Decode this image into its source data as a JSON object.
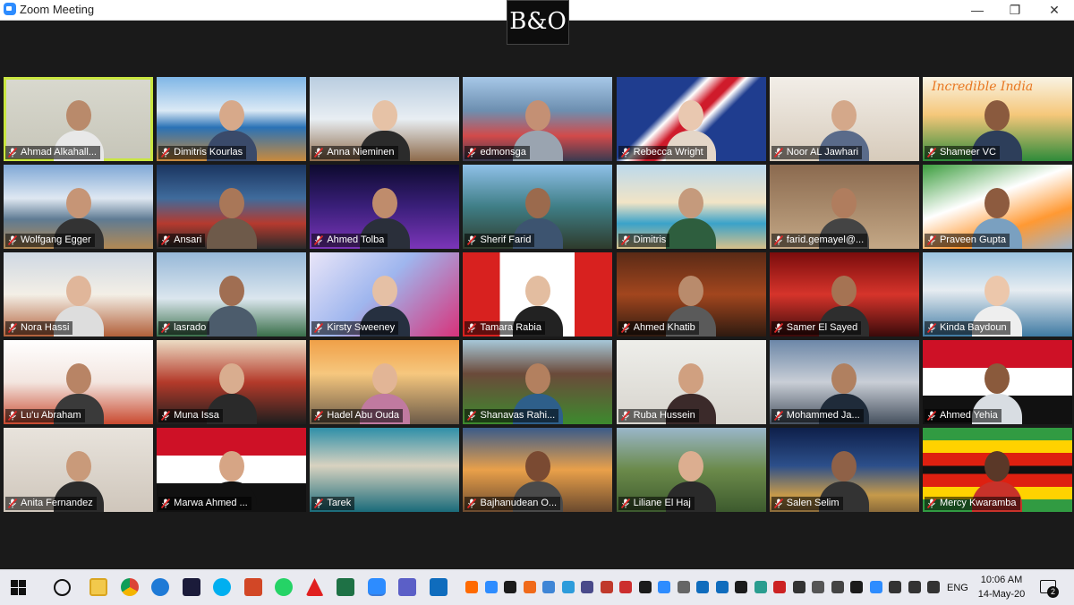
{
  "window": {
    "title": "Zoom Meeting",
    "logo_text": "B&O"
  },
  "participants": [
    {
      "name": "Ahmad Alkahall...",
      "active": true
    },
    {
      "name": "Dimitris Kourlas"
    },
    {
      "name": "Anna Nieminen"
    },
    {
      "name": "edmonsga"
    },
    {
      "name": "Rebecca Wright"
    },
    {
      "name": "Noor AL Jawhari"
    },
    {
      "name": "Shameer VC",
      "bg_text": "Incredible India"
    },
    {
      "name": "Wolfgang Egger"
    },
    {
      "name": "Ansari"
    },
    {
      "name": "Ahmed Tolba"
    },
    {
      "name": "Sherif Farid"
    },
    {
      "name": "Dimitris"
    },
    {
      "name": "farid.gemayel@..."
    },
    {
      "name": "Praveen Gupta"
    },
    {
      "name": "Nora Hassi"
    },
    {
      "name": "lasrado"
    },
    {
      "name": "Kirsty Sweeney"
    },
    {
      "name": "Tamara Rabia"
    },
    {
      "name": "Ahmed Khatib"
    },
    {
      "name": "Samer El Sayed"
    },
    {
      "name": "Kinda Baydoun"
    },
    {
      "name": "Lu'u Abraham"
    },
    {
      "name": "Muna Issa"
    },
    {
      "name": "Hadel Abu Ouda"
    },
    {
      "name": "Shanavas Rahi..."
    },
    {
      "name": "Ruba Hussein"
    },
    {
      "name": "Mohammed Ja..."
    },
    {
      "name": "Ahmed Yehia"
    },
    {
      "name": "Anita Fernandez"
    },
    {
      "name": "Marwa Ahmed ..."
    },
    {
      "name": "Tarek"
    },
    {
      "name": "Bajhanudean O..."
    },
    {
      "name": "Liliane El Haj"
    },
    {
      "name": "Salen Selim"
    },
    {
      "name": "Mercy Kwaramba"
    }
  ],
  "taskbar": {
    "language": "ENG",
    "time": "10:06 AM",
    "date": "14-May-20",
    "notification_count": "2",
    "apps": [
      "file-explorer",
      "chrome",
      "edge",
      "app-bars",
      "skype",
      "powerpoint",
      "whatsapp",
      "acrobat",
      "excel",
      "zoom",
      "teams",
      "outlook"
    ]
  },
  "colors": {
    "active_speaker_border": "#c9e641",
    "mute_icon": "#e02828",
    "background": "#1a1a1a"
  }
}
